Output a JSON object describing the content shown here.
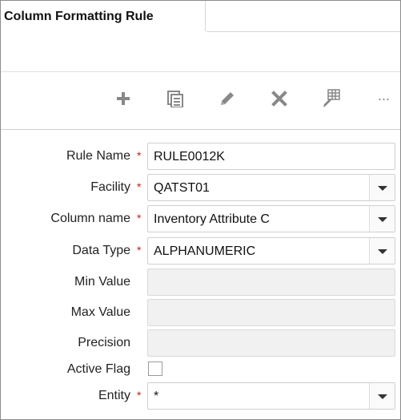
{
  "tab": {
    "title": "Column Formatting Rule"
  },
  "toolbar": {
    "buttons": [
      {
        "icon": "add-icon"
      },
      {
        "icon": "copy-icon"
      },
      {
        "icon": "edit-icon"
      },
      {
        "icon": "delete-icon"
      },
      {
        "icon": "table-edit-icon"
      },
      {
        "icon": "more-icon",
        "text": "···"
      }
    ]
  },
  "form": {
    "required_marker": "*",
    "rule_name": {
      "label": "Rule Name",
      "value": "RULE0012K"
    },
    "facility": {
      "label": "Facility",
      "value": "QATST01"
    },
    "column_name": {
      "label": "Column name",
      "value": "Inventory Attribute C"
    },
    "data_type": {
      "label": "Data Type",
      "value": "ALPHANUMERIC"
    },
    "min_value": {
      "label": "Min Value",
      "value": ""
    },
    "max_value": {
      "label": "Max Value",
      "value": ""
    },
    "precision": {
      "label": "Precision",
      "value": ""
    },
    "active_flag": {
      "label": "Active Flag",
      "checked": false
    },
    "entity": {
      "label": "Entity",
      "value": "*"
    }
  },
  "colors": {
    "required": "#c2211a",
    "icon": "#888888",
    "field_border": "#cfcfcf"
  }
}
